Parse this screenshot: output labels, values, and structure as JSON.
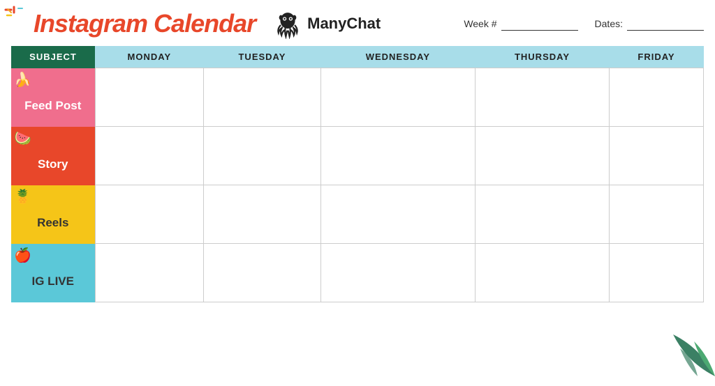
{
  "header": {
    "title": "Instagram Calendar",
    "brand_name": "ManyChat",
    "week_label": "Week #",
    "dates_label": "Dates:",
    "week_value": "",
    "dates_value": ""
  },
  "columns": [
    "SUBJECT",
    "MONDAY",
    "TUESDAY",
    "WEDNESDAY",
    "THURSDAY",
    "FRIDAY"
  ],
  "rows": [
    {
      "id": "feed-post",
      "label": "Feed Post",
      "color": "#f06e8d",
      "text_color": "#fff",
      "fruit": "🍌",
      "class": "feed-post"
    },
    {
      "id": "story",
      "label": "Story",
      "color": "#e8472a",
      "text_color": "#fff",
      "fruit": "🍉",
      "class": "story"
    },
    {
      "id": "reels",
      "label": "Reels",
      "color": "#f5c518",
      "text_color": "#333",
      "fruit": "🍍",
      "class": "reels"
    },
    {
      "id": "ig-live",
      "label": "IG LIVE",
      "color": "#5bc8d8",
      "text_color": "#333",
      "fruit": "🍎",
      "class": "ig-live"
    }
  ],
  "colors": {
    "header_bg": "#a8dde9",
    "subject_bg": "#1a6b4a",
    "accent_orange": "#e8472a"
  }
}
